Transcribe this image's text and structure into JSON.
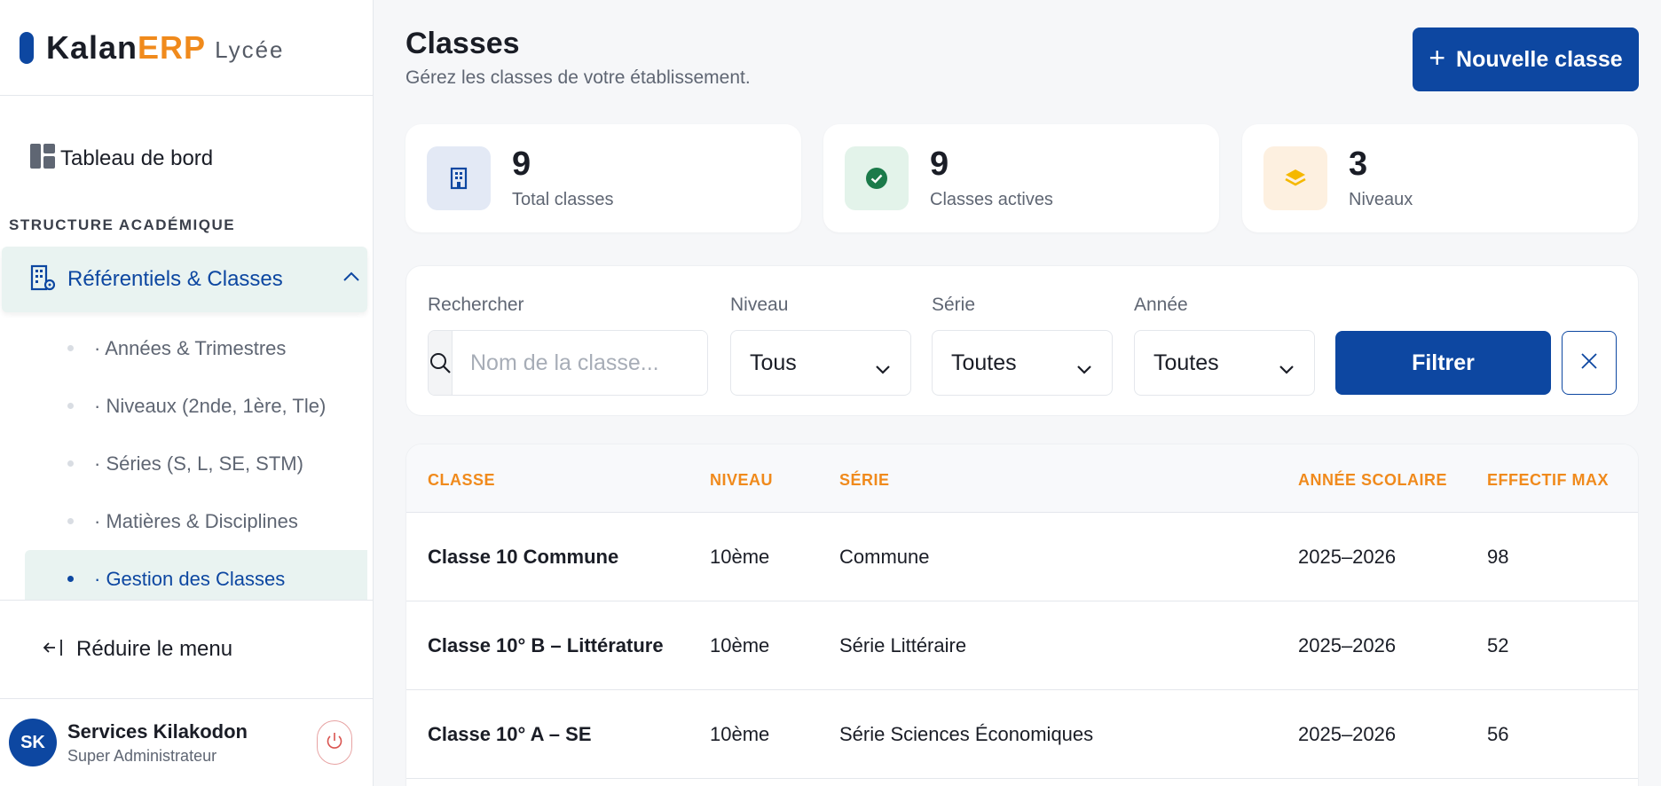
{
  "brand": {
    "name_a": "Kalan",
    "name_b": "ERP",
    "sub": "Lycée"
  },
  "sidebar": {
    "dashboard_label": "Tableau de bord",
    "section_title": "STRUCTURE ACADÉMIQUE",
    "group_label": "Référentiels & Classes",
    "items": [
      {
        "label": "· Années & Trimestres"
      },
      {
        "label": "· Niveaux (2nde, 1ère, Tle)"
      },
      {
        "label": "· Séries (S, L, SE, STM)"
      },
      {
        "label": "· Matières & Disciplines"
      },
      {
        "label": "· Gestion des Classes"
      }
    ],
    "collapse_label": "Réduire le menu"
  },
  "user": {
    "initials": "SK",
    "name": "Services Kilakodon",
    "role": "Super Administrateur"
  },
  "header": {
    "title": "Classes",
    "subtitle": "Gérez les classes de votre établissement.",
    "new_button": "Nouvelle classe",
    "plus": "+"
  },
  "stats": [
    {
      "value": "9",
      "label": "Total classes"
    },
    {
      "value": "9",
      "label": "Classes actives"
    },
    {
      "value": "3",
      "label": "Niveaux"
    }
  ],
  "filters": {
    "search_label": "Rechercher",
    "search_placeholder": "Nom de la classe...",
    "niveau_label": "Niveau",
    "niveau_value": "Tous",
    "serie_label": "Série",
    "serie_value": "Toutes",
    "annee_label": "Année",
    "annee_value": "Toutes",
    "filter_button": "Filtrer"
  },
  "table": {
    "headers": [
      "CLASSE",
      "NIVEAU",
      "SÉRIE",
      "ANNÉE SCOLAIRE",
      "EFFECTIF MAX"
    ],
    "rows": [
      [
        "Classe 10 Commune",
        "10ème",
        "Commune",
        "2025–2026",
        "98"
      ],
      [
        "Classe 10° B – Littérature",
        "10ème",
        "Série Littéraire",
        "2025–2026",
        "52"
      ],
      [
        "Classe 10° A – SE",
        "10ème",
        "Série Sciences Économiques",
        "2025–2026",
        "56"
      ]
    ]
  },
  "colors": {
    "primary": "#0d47a1",
    "accent": "#f08a1c",
    "active_bg": "#e9f3f1"
  },
  "icons": {
    "dashboard": "dashboard-icon",
    "building": "building-gear-icon",
    "check": "check-circle-icon",
    "layers": "layers-icon",
    "search": "search-icon",
    "close": "close-icon",
    "power": "power-icon"
  }
}
